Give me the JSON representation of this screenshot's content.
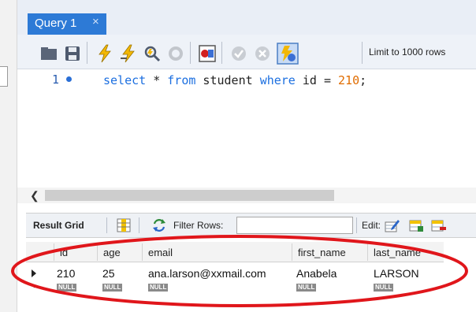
{
  "tab": {
    "title": "Query 1",
    "close_glyph": "×"
  },
  "toolbar": {
    "icons": [
      "open-folder-icon",
      "save-icon",
      "execute-icon",
      "execute-current-icon",
      "explain-icon",
      "stop-icon",
      "toggle-error-icon",
      "commit-icon",
      "rollback-icon",
      "autocommit-icon"
    ],
    "limit_label": "Limit to 1000 rows"
  },
  "editor": {
    "line_number": "1",
    "code": {
      "kw1": "select",
      "p1": " * ",
      "kw2": "from",
      "p2": " student ",
      "kw3": "where",
      "p3": " id = ",
      "num": "210",
      "p4": ";"
    }
  },
  "results": {
    "result_grid_label": "Result Grid",
    "filter_label": "Filter Rows:",
    "filter_value": "",
    "edit_label": "Edit:",
    "columns": [
      "id",
      "age",
      "email",
      "first_name",
      "last_name"
    ],
    "rows": [
      {
        "id": "210",
        "age": "25",
        "email": "ana.larson@xxmail.com",
        "first_name": "Anabela",
        "last_name": "LARSON"
      }
    ],
    "new_row_marker": "*",
    "null_label": "NULL"
  },
  "colors": {
    "accent": "#2d7ad6",
    "keyword": "#1c6fe0",
    "number": "#e06c00",
    "annotation": "#e0161b"
  }
}
